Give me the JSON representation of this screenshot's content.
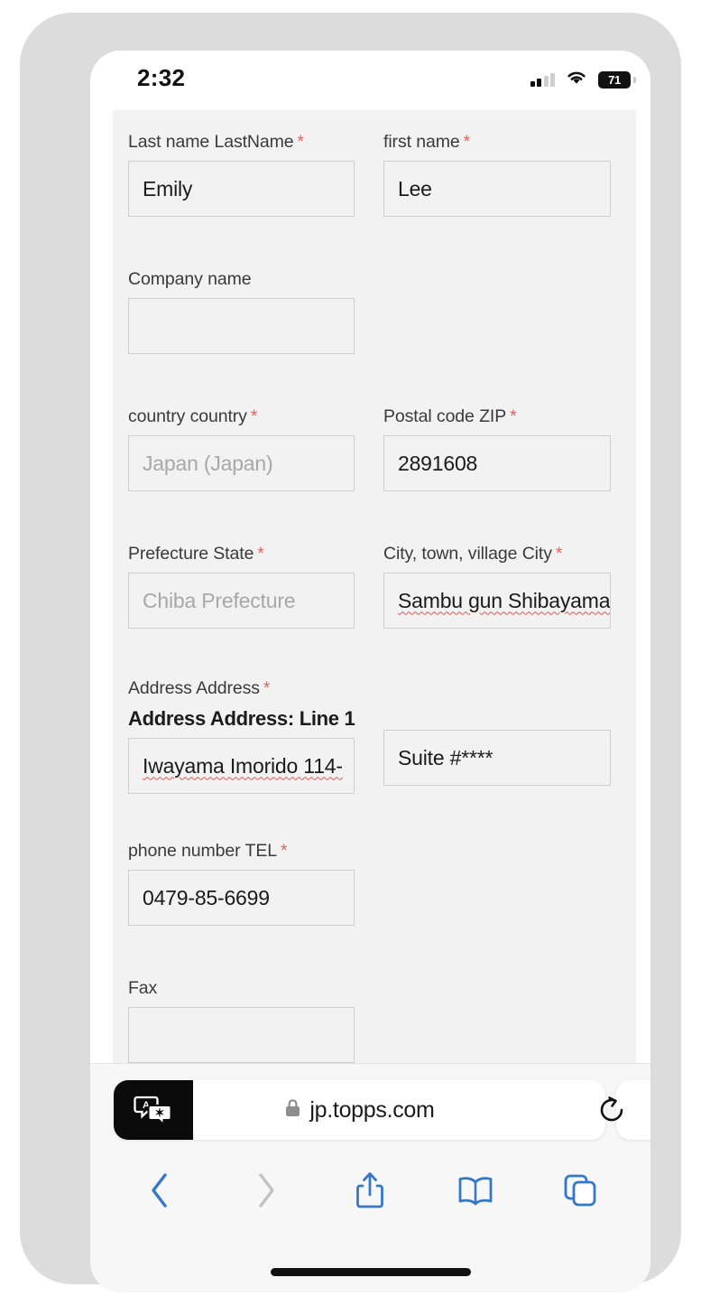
{
  "status_bar": {
    "time": "2:32",
    "battery_level": "71",
    "cellular_icon": "cellular-bars-icon",
    "wifi_icon": "wifi-icon",
    "battery_icon": "battery-icon"
  },
  "form": {
    "fields": [
      {
        "label": "Last name LastName",
        "required": true,
        "value": "Emily",
        "placeholder": "",
        "spellcheck_error": false,
        "name": "last-name"
      },
      {
        "label": "first name",
        "required": true,
        "value": "Lee",
        "placeholder": "",
        "spellcheck_error": false,
        "name": "first-name"
      },
      {
        "label": "Company name",
        "required": false,
        "value": "",
        "placeholder": "",
        "spellcheck_error": false,
        "name": "company-name"
      },
      {
        "label": "country country",
        "required": true,
        "value": "",
        "placeholder": "Japan (Japan)",
        "spellcheck_error": false,
        "name": "country"
      },
      {
        "label": "Postal code ZIP",
        "required": true,
        "value": "2891608",
        "placeholder": "",
        "spellcheck_error": false,
        "name": "postal-code"
      },
      {
        "label": "Prefecture State",
        "required": true,
        "value": "",
        "placeholder": "Chiba Prefecture",
        "spellcheck_error": false,
        "name": "prefecture"
      },
      {
        "label": "City, town, village City",
        "required": true,
        "value": "Sambu gun Shibayama",
        "placeholder": "",
        "spellcheck_error": true,
        "name": "city"
      },
      {
        "label": "Address Address",
        "required": true,
        "sub_label": "Address Address: Line 1",
        "value": "Iwayama Imorido 114-",
        "placeholder": "",
        "spellcheck_error": true,
        "name": "address-line-1"
      },
      {
        "label": "",
        "required": false,
        "value": "Suite #****",
        "placeholder": "",
        "spellcheck_error": false,
        "name": "address-line-2"
      },
      {
        "label": "phone number TEL",
        "required": true,
        "value": "0479-85-6699",
        "placeholder": "",
        "spellcheck_error": false,
        "name": "phone-number"
      },
      {
        "label": "Fax",
        "required": false,
        "value": "",
        "placeholder": "",
        "spellcheck_error": false,
        "name": "fax"
      }
    ],
    "required_marker": "*"
  },
  "browser": {
    "url": "jp.topps.com",
    "lock_icon": "lock-icon",
    "translate_icon": "translate-icon",
    "reload_icon": "reload-icon",
    "toolbar": [
      {
        "name": "back-button",
        "icon": "chevron-left-icon",
        "enabled": true
      },
      {
        "name": "forward-button",
        "icon": "chevron-right-icon",
        "enabled": false
      },
      {
        "name": "share-button",
        "icon": "share-icon",
        "enabled": true
      },
      {
        "name": "bookmarks-button",
        "icon": "book-icon",
        "enabled": true
      },
      {
        "name": "tabs-button",
        "icon": "tabs-icon",
        "enabled": true
      }
    ]
  },
  "colors": {
    "accent": "#3478c8",
    "required": "#e0635f",
    "panel_bg": "#f2f2f2",
    "chrome_bg": "#f7f7f7",
    "spell_underline": "#e2574c"
  }
}
